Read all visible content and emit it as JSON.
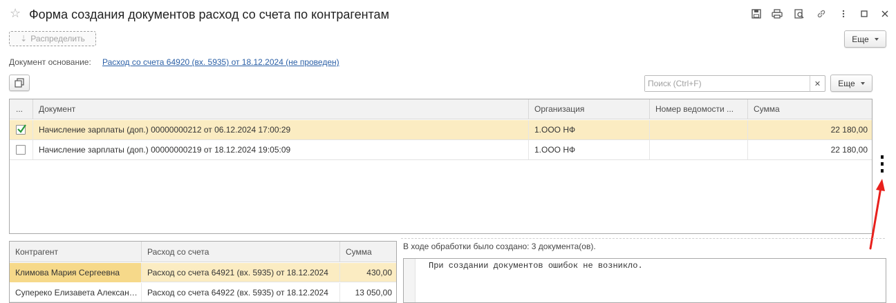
{
  "window": {
    "title": "Форма создания документов расход со счета по контрагентам"
  },
  "toolbar": {
    "distribute_label": "Распределить",
    "more_label": "Еще"
  },
  "basis": {
    "label": "Документ основание:",
    "link": "Расход со счета 64920 (вх. 5935) от 18.12.2024 (не проведен)"
  },
  "search": {
    "placeholder": "Поиск (Ctrl+F)",
    "more_label": "Еще"
  },
  "documents_table": {
    "columns": [
      "...",
      "Документ",
      "Организация",
      "Номер ведомости ...",
      "Сумма"
    ],
    "rows": [
      {
        "checked": true,
        "document": "Начисление зарплаты (доп.) 00000000212 от 06.12.2024 17:00:29",
        "organization": "1.ООО НФ",
        "statement": "",
        "sum": "22 180,00"
      },
      {
        "checked": false,
        "document": "Начисление зарплаты (доп.) 00000000219 от 18.12.2024 19:05:09",
        "organization": "1.ООО НФ",
        "statement": "",
        "sum": "22 180,00"
      }
    ]
  },
  "counterparty_table": {
    "columns": [
      "Контрагент",
      "Расход со счета",
      "Сумма"
    ],
    "rows": [
      {
        "counterparty": "Климова Мария Сергеевна",
        "expense": "Расход со счета 64921 (вх. 5935) от 18.12.2024",
        "sum": "430,00"
      },
      {
        "counterparty": "Суперeко Елизавета Александровна",
        "expense": "Расход со счета 64922 (вх. 5935) от 18.12.2024",
        "sum": "13 050,00"
      }
    ]
  },
  "processing": {
    "status": "В ходе обработки было создано: 3 документа(ов).",
    "log": "При создании документов ошибок не возникло."
  },
  "colors": {
    "selected_row": "#fbecc2",
    "selected_cell": "#f6d98a",
    "link": "#2a5fa6",
    "arrow": "#e8201c"
  }
}
